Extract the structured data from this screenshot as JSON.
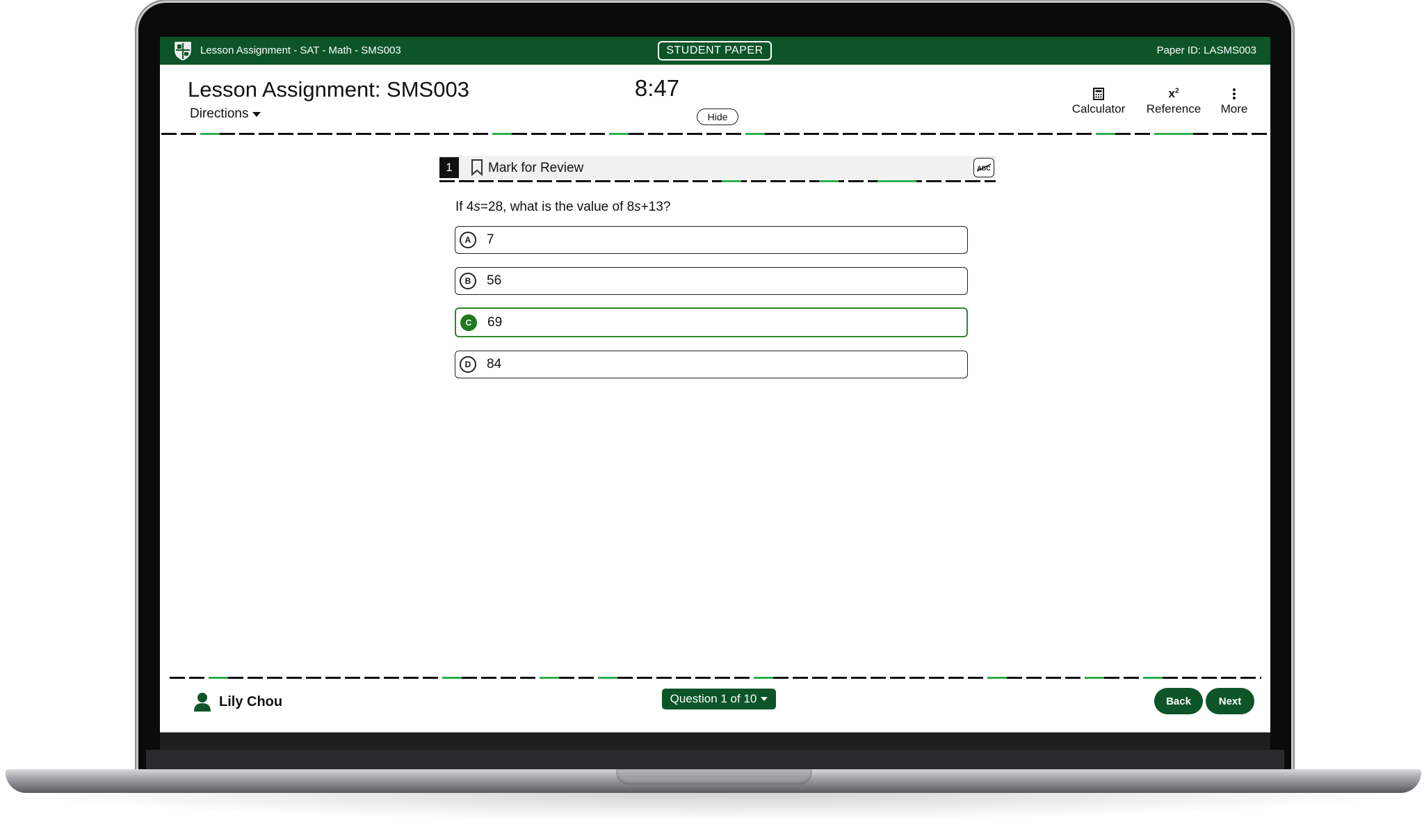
{
  "topbar": {
    "assignment_path": "Lesson Assignment - SAT - Math - SMS003",
    "paper_label": "STUDENT PAPER",
    "paper_id": "Paper ID: LASMS003"
  },
  "header": {
    "title": "Lesson Assignment: SMS003",
    "directions_label": "Directions",
    "timer": "8:47",
    "hide_label": "Hide",
    "tools": {
      "calculator_label": "Calculator",
      "reference_label": "Reference",
      "more_label": "More"
    }
  },
  "question": {
    "number": "1",
    "mark_for_review_label": "Mark for Review",
    "text_prefix": "If 4",
    "var1": "s",
    "text_mid": "=28, what is the value of 8",
    "var2": "s",
    "text_suffix": "+13?",
    "choices": [
      {
        "letter": "A",
        "text": "7",
        "selected": false
      },
      {
        "letter": "B",
        "text": "56",
        "selected": false
      },
      {
        "letter": "C",
        "text": "69",
        "selected": true
      },
      {
        "letter": "D",
        "text": "84",
        "selected": false
      }
    ]
  },
  "footer": {
    "user_name": "Lily Chou",
    "question_nav_label": "Question 1 of 10",
    "back_label": "Back",
    "next_label": "Next"
  },
  "colors": {
    "brand_green": "#0d5528",
    "selected_green": "#1f7a1f",
    "accent_dash": "#2fae4f"
  },
  "icons": [
    "crest-icon",
    "chevron-down-icon",
    "calculator-icon",
    "superscript-icon",
    "more-vertical-icon",
    "bookmark-icon",
    "strikethrough-abc-icon",
    "user-icon"
  ]
}
